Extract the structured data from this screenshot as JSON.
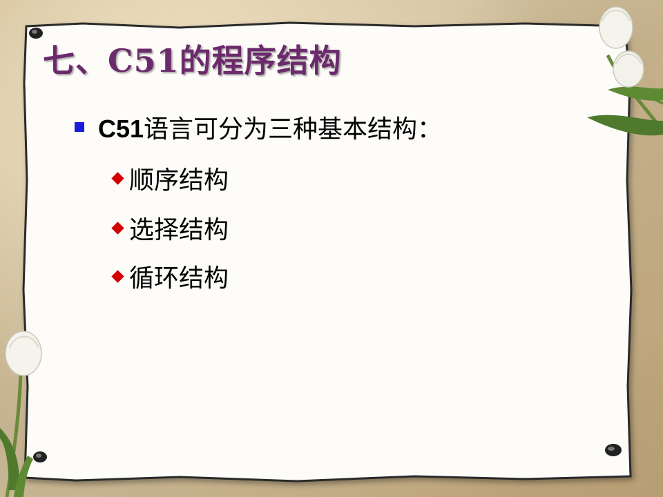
{
  "slide": {
    "title": "七、C51的程序结构",
    "main_bullet": {
      "bold_prefix": "C51",
      "rest": "语言可分为三种基本结构："
    },
    "sub_bullets": [
      {
        "label": "顺序结构"
      },
      {
        "label": "选择结构"
      },
      {
        "label": "循环结构"
      }
    ]
  },
  "colors": {
    "title": "#6b2a6b",
    "square_bullet": "#1a1adc",
    "diamond_bullet": "#d40000",
    "paper": "#fdfcf9"
  },
  "icons": [
    "square-bullet-icon",
    "diamond-bullet-icon",
    "tulip-flower",
    "pushpin-icon"
  ]
}
